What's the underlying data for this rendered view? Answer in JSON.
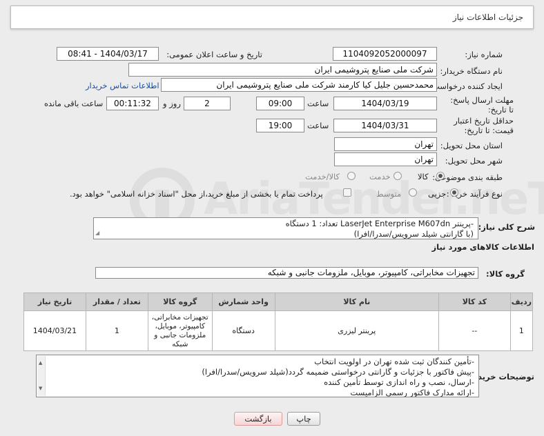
{
  "panel": {
    "title": "جزئیات اطلاعات نیاز"
  },
  "form": {
    "need_number_label": "شماره نیاز:",
    "need_number": "1104092052000097",
    "announce_label": "تاریخ و ساعت اعلان عمومی:",
    "announce_value": "1404/03/17 - 08:41",
    "buyer_org_label": "نام دستگاه خریدار:",
    "buyer_org": "شرکت ملی صنایع پتروشیمی ایران",
    "creator_label": "ایجاد کننده درخواست:",
    "creator": "محمدحسین جلیل کیا کارمند شرکت ملی صنایع پتروشیمی ایران",
    "buyer_contact_link": "اطلاعات تماس خریدار",
    "deadline_label": "مهلت ارسال پاسخ: تا تاریخ:",
    "deadline_date": "1404/03/19",
    "time_label": "ساعت",
    "deadline_time": "09:00",
    "days_count": "2",
    "days_label": "روز و",
    "remaining_time": "00:11:32",
    "remaining_label": "ساعت باقی مانده",
    "price_validity_label": "حداقل تاریخ اعتبار قیمت: تا تاریخ:",
    "validity_date": "1404/03/31",
    "validity_time": "19:00",
    "province_label": "استان محل تحویل:",
    "province": "تهران",
    "city_label": "شهر محل تحویل:",
    "city": "تهران",
    "category_label": "طبقه بندی موضوعی:",
    "category_options": [
      "کالا",
      "خدمت",
      "کالا/خدمت"
    ],
    "category_selected": "کالا",
    "process_label": "نوع فرآیند خرید :",
    "process_options": [
      "جزیی",
      "متوسط"
    ],
    "process_selected": "جزیی",
    "treasury_note": "پرداخت تمام یا بخشی از مبلغ خرید،از محل \"اسناد خزانه اسلامی\" خواهد بود."
  },
  "summary": {
    "label": "شرح کلی نیاز:",
    "text_line1": "-پرینتر LaserJet Enterprise M607dn تعداد: 1 دستگاه",
    "text_line2": "(با گارانتی شیلد سرویس/سدرا/افرا)"
  },
  "goods_section": {
    "title": "اطلاعات کالاهای مورد نیاز",
    "group_label": "گروه کالا:",
    "group_value": "تجهیزات مخابراتی، کامپیوتر، موبایل، ملزومات جانبی و شبکه"
  },
  "table": {
    "headers": [
      "ردیف",
      "کد کالا",
      "نام کالا",
      "واحد شمارش",
      "گروه کالا",
      "تعداد / مقدار",
      "تاریخ نیاز"
    ],
    "rows": [
      [
        "1",
        "--",
        "پرینتر لیزری",
        "دستگاه",
        "تجهیزات مخابراتی، کامپیوتر، موبایل، ملزومات جانبی و شبکه",
        "1",
        "1404/03/21"
      ]
    ]
  },
  "buyer_notes": {
    "label": "توضیحات خریدار:",
    "lines": [
      "-تأمین کنندگان ثبت شده تهران در اولویت انتخاب",
      "-پیش فاکتور با جزئیات و گارانتی درخواستی ضمیمه گردد(شیلد سرویس/سدرا/افرا)",
      "-ارسال، نصب و راه اندازی توسط تأمین کننده",
      "-ارائه مدارک فاکتور رسمی  الزامیست"
    ]
  },
  "buttons": {
    "print": "چاپ",
    "back": "بازگشت"
  },
  "colors": {
    "link": "#1a4ea0",
    "header_bg": "#d2d2d2",
    "page_bg": "#ececec"
  }
}
